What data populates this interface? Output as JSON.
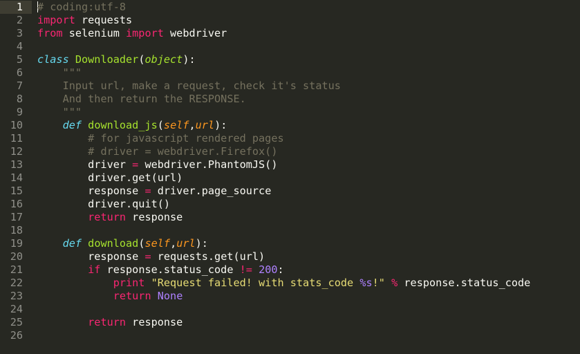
{
  "editor": {
    "theme": "monokai",
    "colors": {
      "background": "#272822",
      "foreground": "#f8f8f2",
      "comment": "#75715e",
      "keyword": "#f92672",
      "storage": "#66d9ef",
      "function": "#a6e22e",
      "parameter": "#fd971f",
      "string": "#e6db74",
      "number": "#ae81ff",
      "gutter_text": "#90908a",
      "active_line": "#3e3d32"
    },
    "active_line": 1,
    "lines": [
      {
        "n": "1",
        "tokens": [
          [
            "cm",
            "# coding:utf-8"
          ]
        ]
      },
      {
        "n": "2",
        "tokens": [
          [
            "kw",
            "import"
          ],
          [
            "id",
            " requests"
          ]
        ]
      },
      {
        "n": "3",
        "tokens": [
          [
            "kw",
            "from"
          ],
          [
            "id",
            " selenium "
          ],
          [
            "kw",
            "import"
          ],
          [
            "id",
            " webdriver"
          ]
        ]
      },
      {
        "n": "4",
        "tokens": []
      },
      {
        "n": "5",
        "tokens": [
          [
            "st",
            "class"
          ],
          [
            "id",
            " "
          ],
          [
            "cls",
            "Downloader"
          ],
          [
            "id",
            "("
          ],
          [
            "base",
            "object"
          ],
          [
            "id",
            "):"
          ]
        ]
      },
      {
        "n": "6",
        "tokens": [
          [
            "id",
            "    "
          ],
          [
            "cm",
            "\"\"\""
          ]
        ]
      },
      {
        "n": "7",
        "tokens": [
          [
            "id",
            "    "
          ],
          [
            "cm",
            "Input url, make a request, check it's status"
          ]
        ]
      },
      {
        "n": "8",
        "tokens": [
          [
            "id",
            "    "
          ],
          [
            "cm",
            "And then return the RESPONSE."
          ]
        ]
      },
      {
        "n": "9",
        "tokens": [
          [
            "id",
            "    "
          ],
          [
            "cm",
            "\"\"\""
          ]
        ]
      },
      {
        "n": "10",
        "tokens": [
          [
            "id",
            "    "
          ],
          [
            "st",
            "def"
          ],
          [
            "id",
            " "
          ],
          [
            "fn",
            "download_js"
          ],
          [
            "id",
            "("
          ],
          [
            "par",
            "self"
          ],
          [
            "id",
            ","
          ],
          [
            "par",
            "url"
          ],
          [
            "id",
            "):"
          ]
        ]
      },
      {
        "n": "11",
        "tokens": [
          [
            "id",
            "        "
          ],
          [
            "cm",
            "# for javascript rendered pages"
          ]
        ]
      },
      {
        "n": "12",
        "tokens": [
          [
            "id",
            "        "
          ],
          [
            "cm",
            "# driver = webdriver.Firefox()"
          ]
        ]
      },
      {
        "n": "13",
        "tokens": [
          [
            "id",
            "        driver "
          ],
          [
            "op",
            "="
          ],
          [
            "id",
            " webdriver.PhantomJS()"
          ]
        ]
      },
      {
        "n": "14",
        "tokens": [
          [
            "id",
            "        driver.get(url)"
          ]
        ]
      },
      {
        "n": "15",
        "tokens": [
          [
            "id",
            "        response "
          ],
          [
            "op",
            "="
          ],
          [
            "id",
            " driver.page_source"
          ]
        ]
      },
      {
        "n": "16",
        "tokens": [
          [
            "id",
            "        driver.quit()"
          ]
        ]
      },
      {
        "n": "17",
        "tokens": [
          [
            "id",
            "        "
          ],
          [
            "kw",
            "return"
          ],
          [
            "id",
            " response"
          ]
        ]
      },
      {
        "n": "18",
        "tokens": []
      },
      {
        "n": "19",
        "tokens": [
          [
            "id",
            "    "
          ],
          [
            "st",
            "def"
          ],
          [
            "id",
            " "
          ],
          [
            "fn",
            "download"
          ],
          [
            "id",
            "("
          ],
          [
            "par",
            "self"
          ],
          [
            "id",
            ","
          ],
          [
            "par",
            "url"
          ],
          [
            "id",
            "):"
          ]
        ]
      },
      {
        "n": "20",
        "tokens": [
          [
            "id",
            "        response "
          ],
          [
            "op",
            "="
          ],
          [
            "id",
            " requests.get(url)"
          ]
        ]
      },
      {
        "n": "21",
        "tokens": [
          [
            "id",
            "        "
          ],
          [
            "kw",
            "if"
          ],
          [
            "id",
            " response.status_code "
          ],
          [
            "op",
            "!="
          ],
          [
            "id",
            " "
          ],
          [
            "num",
            "200"
          ],
          [
            "id",
            ":"
          ]
        ]
      },
      {
        "n": "22",
        "tokens": [
          [
            "id",
            "            "
          ],
          [
            "kw",
            "print"
          ],
          [
            "id",
            " "
          ],
          [
            "str",
            "\"Request failed! with stats_code "
          ],
          [
            "fmt",
            "%s"
          ],
          [
            "str",
            "!\""
          ],
          [
            "id",
            " "
          ],
          [
            "op",
            "%"
          ],
          [
            "id",
            " response.status_code"
          ]
        ]
      },
      {
        "n": "23",
        "tokens": [
          [
            "id",
            "            "
          ],
          [
            "kw",
            "return"
          ],
          [
            "id",
            " "
          ],
          [
            "const",
            "None"
          ]
        ]
      },
      {
        "n": "24",
        "tokens": []
      },
      {
        "n": "25",
        "tokens": [
          [
            "id",
            "        "
          ],
          [
            "kw",
            "return"
          ],
          [
            "id",
            " response"
          ]
        ]
      },
      {
        "n": "26",
        "tokens": []
      }
    ]
  }
}
